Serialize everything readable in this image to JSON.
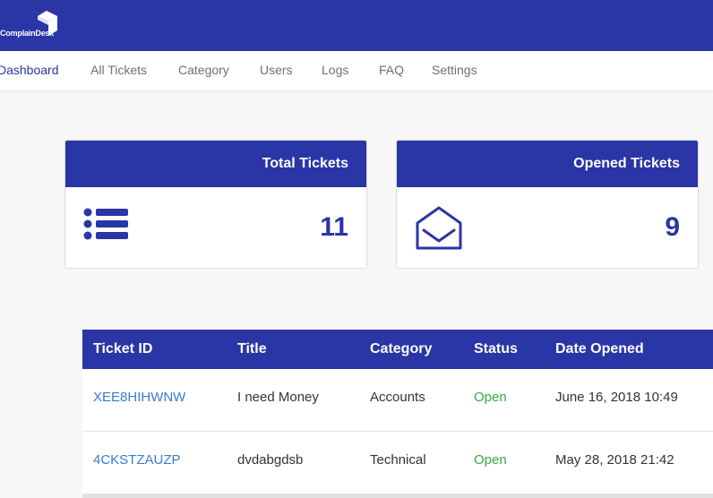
{
  "brand": {
    "name": "ComplainDesk",
    "color": "#2a35a6"
  },
  "nav": {
    "items": [
      {
        "label": "Dashboard",
        "active": true
      },
      {
        "label": "All Tickets"
      },
      {
        "label": "Category"
      },
      {
        "label": "Users"
      },
      {
        "label": "Logs"
      },
      {
        "label": "FAQ"
      },
      {
        "label": "Settings"
      }
    ]
  },
  "cards": [
    {
      "title": "Total Tickets",
      "value": "11",
      "icon": "list-icon"
    },
    {
      "title": "Opened Tickets",
      "value": "9",
      "icon": "open-envelope-icon"
    }
  ],
  "table": {
    "headers": [
      "Ticket ID",
      "Title",
      "Category",
      "Status",
      "Date Opened"
    ],
    "rows": [
      {
        "id": "XEE8HIHWNW",
        "title": "I need Money",
        "category": "Accounts",
        "status": "Open",
        "date": "June 16, 2018 10:49"
      },
      {
        "id": "4CKSTZAUZP",
        "title": "dvdabgdsb",
        "category": "Technical",
        "status": "Open",
        "date": "May 28, 2018 21:42"
      }
    ]
  },
  "colors": {
    "status_open": "#3aa54a",
    "link": "#3a7bd5"
  }
}
